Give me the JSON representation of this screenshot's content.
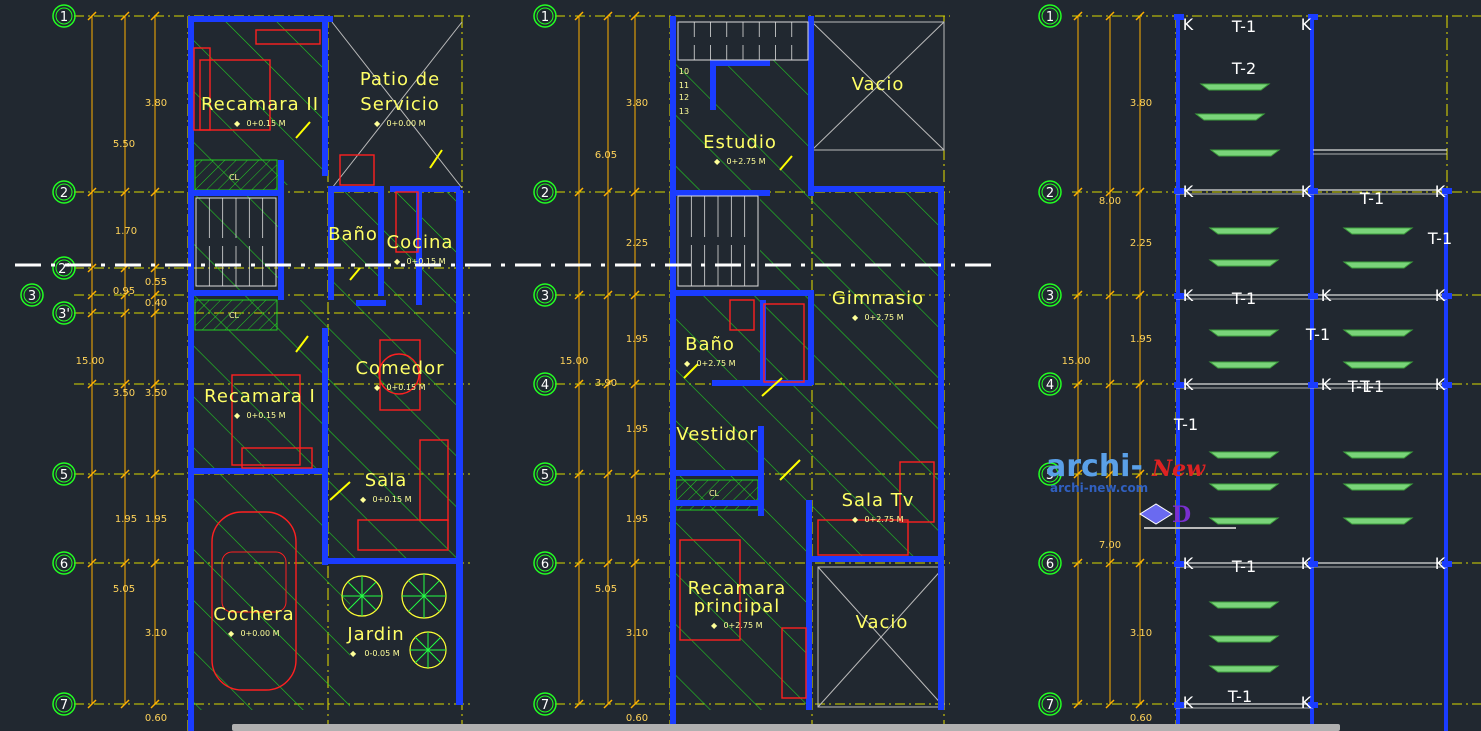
{
  "axes": {
    "rows": [
      {
        "label": "1"
      },
      {
        "label": "2"
      },
      {
        "label": "2'"
      },
      {
        "label": "3"
      },
      {
        "label": "3'"
      },
      {
        "label": "4"
      },
      {
        "label": "5"
      },
      {
        "label": "6"
      },
      {
        "label": "7"
      }
    ]
  },
  "plan_ground": {
    "outer_dims": [
      "5.50",
      "1.70",
      "0.95",
      "0.55",
      "0.40",
      "15.00",
      "3.50",
      "1.95",
      "5.05",
      "0.60"
    ],
    "inner_dims": [
      "3.80",
      "3.50",
      "1.95",
      "3.10"
    ],
    "rooms": [
      {
        "name": "Recamara II",
        "level": "0+0.15 M"
      },
      {
        "name": "Patio de",
        "name2": "Servicio",
        "level": "0+0.00 M"
      },
      {
        "name": "Baño",
        "level": ""
      },
      {
        "name": "Cocina",
        "level": "0+0.15 M"
      },
      {
        "name": "Comedor",
        "level": "0+0.15 M"
      },
      {
        "name": "Recamara I",
        "level": "0+0.15 M"
      },
      {
        "name": "Sala",
        "level": "0+0.15 M"
      },
      {
        "name": "Cochera",
        "level": "0+0.00 M"
      },
      {
        "name": "Jardin",
        "level": "0-0.05 M"
      }
    ],
    "closets": [
      "CL",
      "CL"
    ]
  },
  "plan_upper": {
    "outer_dims": [
      "6.05",
      "15.00"
    ],
    "inner_dims": [
      "3.80",
      "2.25",
      "1.95",
      "3.90",
      "1.95",
      "1.95",
      "5.05",
      "3.10",
      "0.60"
    ],
    "rooms": [
      {
        "name": "Vacio",
        "level": ""
      },
      {
        "name": "Estudio",
        "level": "0+2.75 M"
      },
      {
        "name": "Gimnasio",
        "level": "0+2.75 M"
      },
      {
        "name": "Baño",
        "level": "0+2.75 M"
      },
      {
        "name": "Vestidor",
        "level": ""
      },
      {
        "name": "Sala Tv",
        "level": "0+2.75 M"
      },
      {
        "name": "Recamara",
        "name2": "principal",
        "level": "0+2.75 M"
      },
      {
        "name": "Vacio",
        "level": ""
      }
    ],
    "closets": [
      "CL"
    ],
    "stair_numbers": [
      "10",
      "11",
      "12",
      "13"
    ]
  },
  "plan_roof": {
    "outer_dims": [
      "8.00",
      "15.00",
      "7.00"
    ],
    "inner_dims": [
      "3.80",
      "2.25",
      "1.95",
      "3.10",
      "0.60"
    ],
    "beam_labels": [
      "T-1",
      "T-2",
      "T-1",
      "T-1",
      "T-1",
      "T-1",
      "T-1",
      "T-1",
      "T-1",
      "T-1",
      "T-1"
    ],
    "column_mark": "K"
  },
  "ground_left_dims": [
    "0.60"
  ],
  "watermark": {
    "brand": "archi-",
    "brand2": "New",
    "url": "archi-new.com"
  },
  "colors": {
    "background": "#212830",
    "wall": "#1a3cff",
    "hatch": "#22cc22",
    "axis": "#d8d800",
    "dims": "#ffb000",
    "furniture": "#ff2020",
    "bubble": "#22ff22",
    "room_text": "#ffff66"
  }
}
